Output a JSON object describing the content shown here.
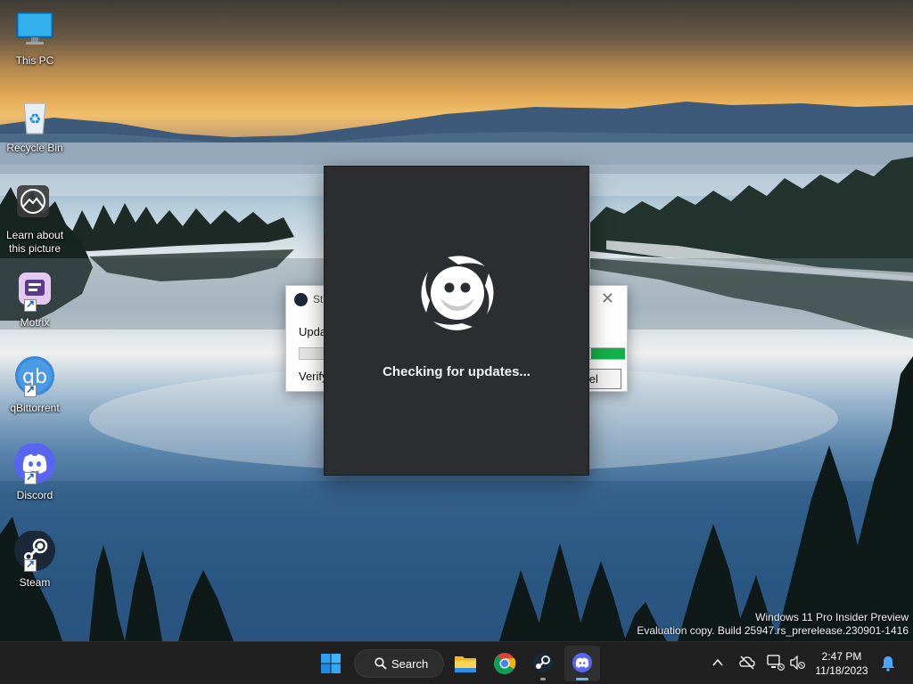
{
  "desktop": {
    "icons": [
      {
        "name": "This PC"
      },
      {
        "name": "Recycle Bin"
      },
      {
        "name": "Learn about this picture"
      },
      {
        "name": "Motrix"
      },
      {
        "name": "qBittorrent"
      },
      {
        "name": "Discord"
      },
      {
        "name": "Steam"
      }
    ]
  },
  "steam_window": {
    "title": "St",
    "status": "Upda",
    "verify": "Verify",
    "cancel": "ncel",
    "close": "✕",
    "progress": 0.1
  },
  "discord_updater": {
    "status": "Checking for updates..."
  },
  "watermark": {
    "line1": "Windows 11 Pro Insider Preview",
    "line2": "Evaluation copy. Build 25947.rs_prerelease.230901-1416"
  },
  "taskbar": {
    "search_label": "Search",
    "apps": [
      "start-icon",
      "file-explorer-icon",
      "chrome-icon",
      "steam-icon",
      "discord-icon"
    ],
    "clock": {
      "time": "2:47 PM",
      "date": "11/18/2023"
    }
  },
  "colors": {
    "taskbar": "#202020",
    "discord_window": "#2b2d31",
    "discord_blurple": "#5865f2",
    "steam_progress": "#12b24a",
    "accent": "#66b4ff"
  }
}
